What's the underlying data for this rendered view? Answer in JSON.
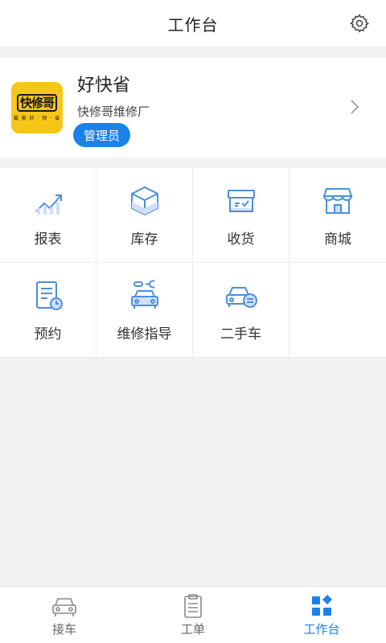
{
  "header": {
    "title": "工作台"
  },
  "profile": {
    "logo_text": "快修哥",
    "logo_subtext": "载 美 好 · 快 · 省",
    "store_name": "好快省",
    "company": "快修哥维修厂",
    "role": "管理员"
  },
  "grid": {
    "items": [
      {
        "label": "报表",
        "icon": "chart-icon"
      },
      {
        "label": "库存",
        "icon": "box-icon"
      },
      {
        "label": "收货",
        "icon": "receive-icon"
      },
      {
        "label": "商城",
        "icon": "store-icon"
      },
      {
        "label": "预约",
        "icon": "appointment-icon"
      },
      {
        "label": "维修指导",
        "icon": "repair-guide-icon"
      },
      {
        "label": "二手车",
        "icon": "used-car-icon"
      }
    ]
  },
  "nav": {
    "items": [
      {
        "label": "接车",
        "icon": "car-icon",
        "active": false
      },
      {
        "label": "工单",
        "icon": "clipboard-icon",
        "active": false
      },
      {
        "label": "工作台",
        "icon": "dashboard-icon",
        "active": true
      }
    ]
  },
  "colors": {
    "accent": "#1a82e8",
    "icon_blue": "#4a8fe0",
    "logo_yellow": "#f5c518"
  }
}
